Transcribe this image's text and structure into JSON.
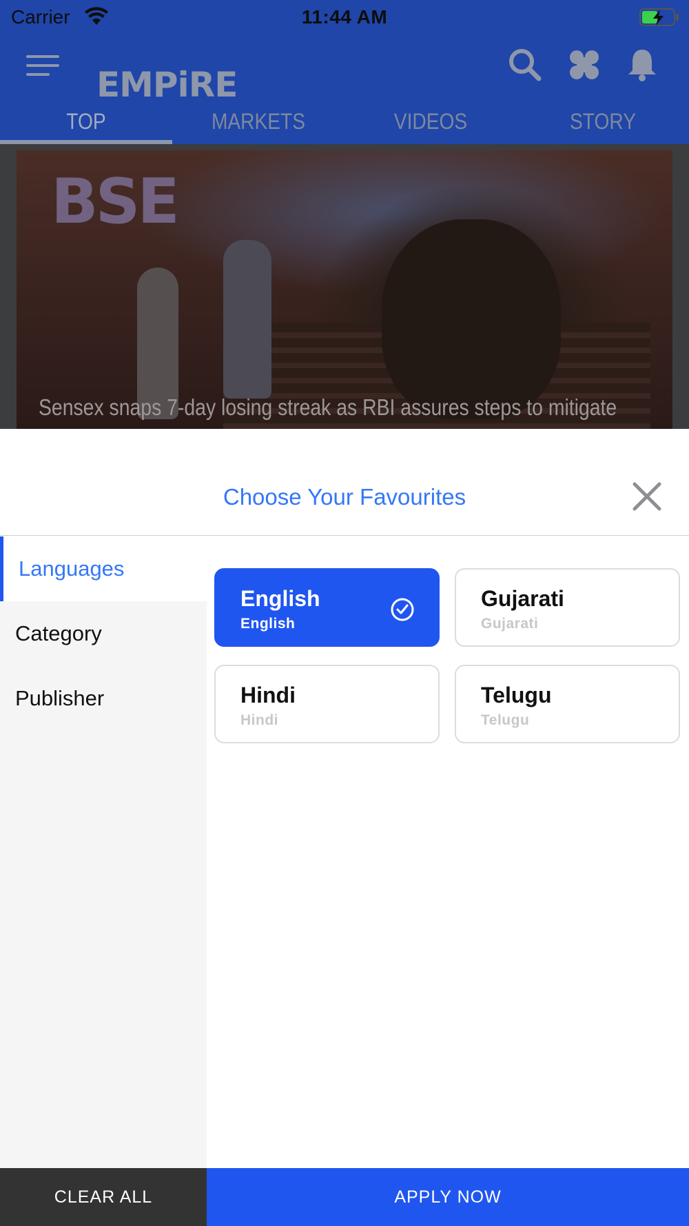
{
  "status_bar": {
    "carrier": "Carrier",
    "time": "11:44 AM"
  },
  "app": {
    "logo": "EMPiRE",
    "tabs": [
      {
        "label": "TOP",
        "active": true
      },
      {
        "label": "MARKETS",
        "active": false
      },
      {
        "label": "VIDEOS",
        "active": false
      },
      {
        "label": "STORY",
        "active": false
      }
    ],
    "hero": {
      "headline": "Sensex snaps 7-day losing streak as RBI assures steps to mitigate",
      "sign_text": "BSE"
    },
    "header_icons": [
      "menu-icon",
      "search-icon",
      "grid-icon",
      "bell-icon"
    ]
  },
  "favourites": {
    "title": "Choose Your Favourites",
    "sidebar": [
      {
        "label": "Languages",
        "active": true
      },
      {
        "label": "Category",
        "active": false
      },
      {
        "label": "Publisher",
        "active": false
      }
    ],
    "languages": [
      {
        "name": "English",
        "native": "English",
        "selected": true
      },
      {
        "name": "Gujarati",
        "native": "Gujarati",
        "selected": false
      },
      {
        "name": "Hindi",
        "native": "Hindi",
        "selected": false
      },
      {
        "name": "Telugu",
        "native": "Telugu",
        "selected": false
      }
    ],
    "clear_label": "CLEAR ALL",
    "apply_label": "APPLY NOW"
  },
  "colors": {
    "accent": "#2056f0",
    "title_blue": "#3478f6",
    "header_bg": "#1f46a8",
    "clear_bg": "#333333"
  }
}
